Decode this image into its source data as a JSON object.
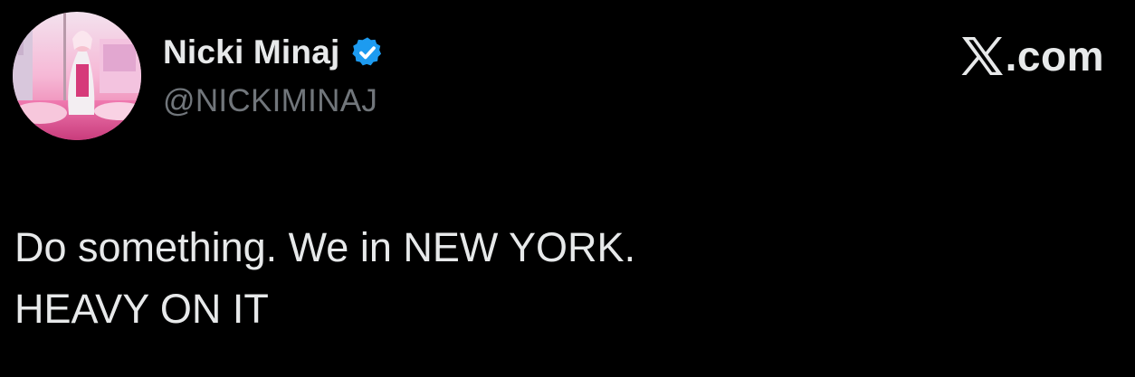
{
  "author": {
    "display_name": "Nicki Minaj",
    "handle": "@NICKIMINAJ",
    "verified": true,
    "avatar_icon": "profile-photo",
    "verified_icon": "verified-badge-icon"
  },
  "brand": {
    "logo_icon": "x-logo-icon",
    "domain": ".com"
  },
  "tweet": {
    "lines": [
      "Do something. We in NEW YORK.",
      "HEAVY ON IT"
    ]
  },
  "colors": {
    "background": "#000000",
    "primary_text": "#e7e9ea",
    "secondary_text": "#71767b",
    "verified_blue": "#1d9bf0"
  }
}
